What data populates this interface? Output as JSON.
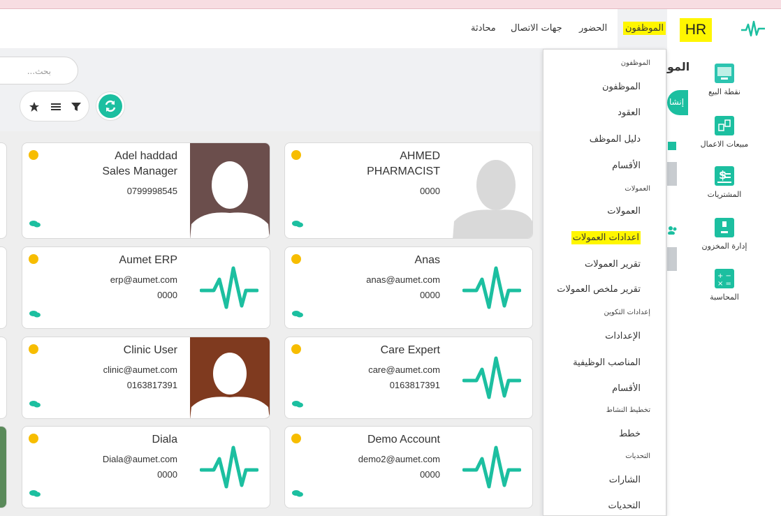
{
  "brand": {
    "hr_label": "HR",
    "logo_icon": "pulse-logo-icon",
    "accent_color": "#1cbfa0",
    "highlight_color": "#fff600"
  },
  "sidebar": {
    "items": [
      {
        "label": "نقطة البيع",
        "icon": "monitor-icon"
      },
      {
        "label": "مبيعات الاعمال",
        "icon": "business-sales-icon"
      },
      {
        "label": "المشتريات",
        "icon": "dollar-icon"
      },
      {
        "label": "إدارة المخزون",
        "icon": "inventory-box-icon"
      },
      {
        "label": "المحاسبة",
        "icon": "calculator-icon"
      }
    ]
  },
  "navbar": {
    "items": [
      {
        "label": "الموظفون",
        "active": true
      },
      {
        "label": "الحضور"
      },
      {
        "label": "جهات الاتصال"
      },
      {
        "label": "محادثة"
      }
    ]
  },
  "search": {
    "placeholder": "بحث..."
  },
  "side": {
    "title": "المو",
    "button_label": "إنشا"
  },
  "dropdown": {
    "items": [
      {
        "label": "الموظفون",
        "header": true
      },
      {
        "label": "الموظفون"
      },
      {
        "label": "العقود"
      },
      {
        "label": "دليل الموظف"
      },
      {
        "label": "الأقسام"
      },
      {
        "label": "العمولات",
        "header": true
      },
      {
        "label": "العمولات"
      },
      {
        "label": "اعدادات العمولات",
        "highlight": true
      },
      {
        "label": "تقرير العمولات"
      },
      {
        "label": "تقرير ملخص العمولات"
      },
      {
        "label": "إعدادات التكوين",
        "header": true
      },
      {
        "label": "الإعدادات"
      },
      {
        "label": "المناصب الوظيفية"
      },
      {
        "label": "الأقسام"
      },
      {
        "label": "تخطيط النشاط",
        "header": true
      },
      {
        "label": "خطط"
      },
      {
        "label": "التحديات",
        "header": true
      },
      {
        "label": "الشارات"
      },
      {
        "label": "التحديات"
      }
    ]
  },
  "cards": [
    {
      "name": "AHMED",
      "line1": "PHARMACIST",
      "line2": "0000",
      "avatar": "grey-silhouette"
    },
    {
      "name": "Adel haddad",
      "line1": "Sales Manager",
      "line2": "0799998545",
      "avatar": "brown-silhouette"
    },
    {
      "name": "Anas",
      "line1": "anas@aumet.com",
      "line2": "0000",
      "avatar": "logo"
    },
    {
      "name": "Aumet ERP",
      "line1": "erp@aumet.com",
      "line2": "0000",
      "avatar": "logo"
    },
    {
      "name": "Care Expert",
      "line1": "care@aumet.com",
      "line2": "0163817391",
      "avatar": "logo"
    },
    {
      "name": "Clinic User",
      "line1": "clinic@aumet.com",
      "line2": "0163817391",
      "avatar": "rust-silhouette"
    },
    {
      "name": "Demo Account",
      "line1": "demo2@aumet.com",
      "line2": "0000",
      "avatar": "logo"
    },
    {
      "name": "Diala",
      "line1": "Diala@aumet.com",
      "line2": "0000",
      "avatar": "logo"
    }
  ]
}
